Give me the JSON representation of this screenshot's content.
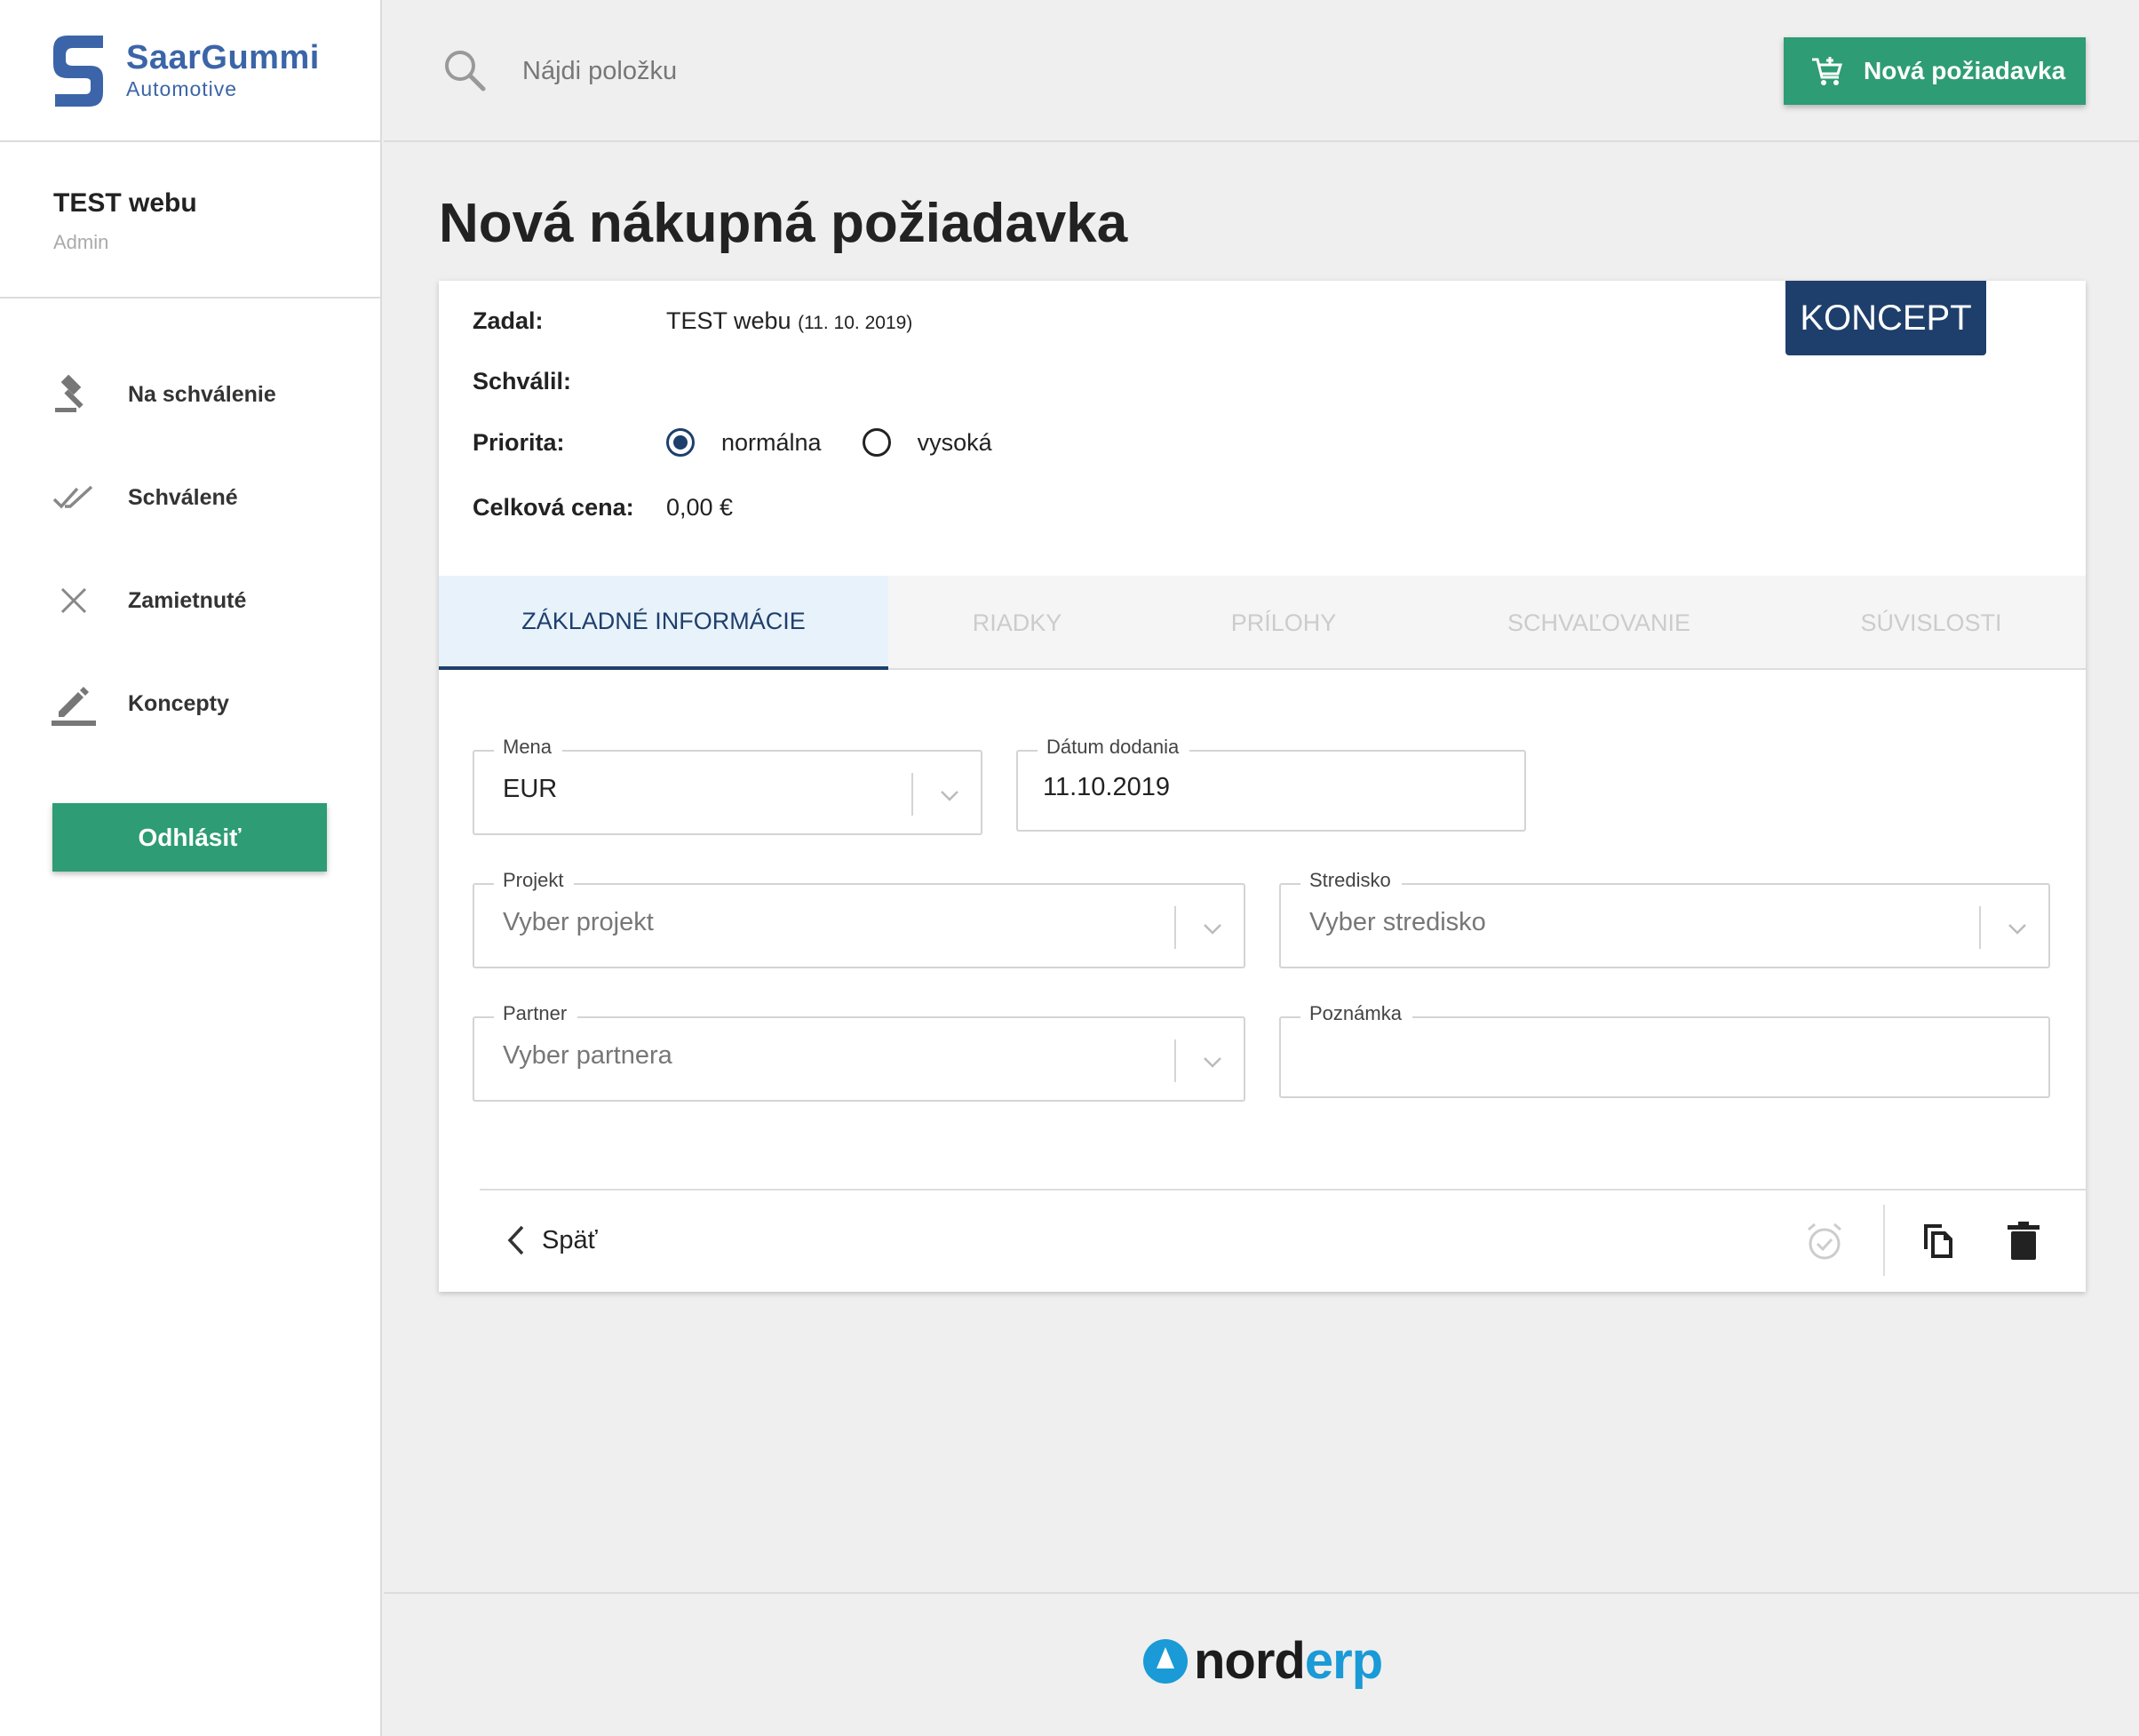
{
  "brand": {
    "name": "SaarGummi",
    "subtitle": "Automotive",
    "footer_part1": "nord",
    "footer_part2": "erp",
    "accent": "#3b65a8"
  },
  "user": {
    "name": "TEST webu",
    "role": "Admin"
  },
  "nav": {
    "items": [
      {
        "label": "Na schválenie",
        "icon": "gavel-icon"
      },
      {
        "label": "Schválené",
        "icon": "double-check-icon"
      },
      {
        "label": "Zamietnuté",
        "icon": "close-icon"
      },
      {
        "label": "Koncepty",
        "icon": "edit-icon"
      }
    ],
    "logout_label": "Odhlásiť"
  },
  "search": {
    "placeholder": "Nájdi položku"
  },
  "header": {
    "new_request_label": "Nová požiadavka"
  },
  "page": {
    "title": "Nová nákupná požiadavka"
  },
  "request": {
    "status": "KONCEPT",
    "zadal_label": "Zadal:",
    "zadal_value": "TEST webu",
    "zadal_date": "(11. 10. 2019)",
    "schvalil_label": "Schválil:",
    "priorita_label": "Priorita:",
    "priority_options": [
      "normálna",
      "vysoká"
    ],
    "priority_selected": "normálna",
    "celkova_cena_label": "Celková cena:",
    "celkova_cena_value": "0,00 €"
  },
  "tabs": [
    {
      "label": "ZÁKLADNÉ INFORMÁCIE",
      "active": true
    },
    {
      "label": "RIADKY",
      "active": false
    },
    {
      "label": "PRÍLOHY",
      "active": false
    },
    {
      "label": "SCHVAĽOVANIE",
      "active": false
    },
    {
      "label": "SÚVISLOSTI",
      "active": false
    }
  ],
  "form": {
    "mena": {
      "label": "Mena",
      "value": "EUR"
    },
    "datum": {
      "label": "Dátum dodania",
      "value": "11.10.2019"
    },
    "projekt": {
      "label": "Projekt",
      "placeholder": "Vyber projekt"
    },
    "stredisko": {
      "label": "Stredisko",
      "placeholder": "Vyber stredisko"
    },
    "partner": {
      "label": "Partner",
      "placeholder": "Vyber partnera"
    },
    "poznamka": {
      "label": "Poznámka",
      "value": ""
    }
  },
  "actions": {
    "back_label": "Späť",
    "icons": [
      "alarm-check-icon",
      "copy-icon",
      "delete-icon"
    ]
  },
  "colors": {
    "primary_green": "#2e9c74",
    "navy": "#1e3f6c",
    "norderp_blue": "#1a9ad7"
  }
}
